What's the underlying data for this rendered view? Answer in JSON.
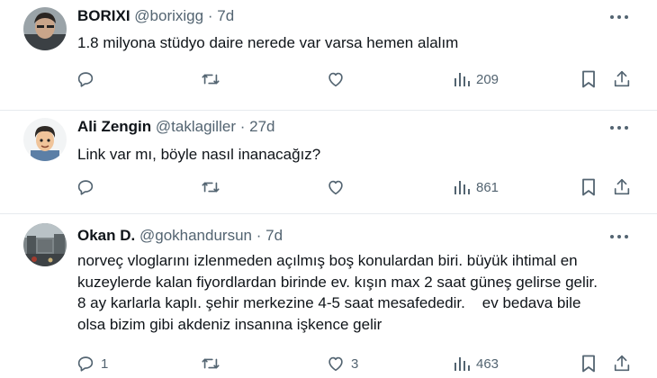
{
  "tweets": [
    {
      "name": "BORIXI",
      "handle": "@borixigg",
      "separator": "·",
      "time": "7d",
      "text_lines": [
        "1.8 milyona stüdyo daire nerede var varsa hemen alalım"
      ],
      "reply_count": "",
      "like_count": "",
      "views": "209"
    },
    {
      "name": "Ali Zengin",
      "handle": "@taklagiller",
      "separator": "·",
      "time": "27d",
      "text_lines": [
        "Link var mı, böyle nasıl inanacağız?"
      ],
      "reply_count": "",
      "like_count": "",
      "views": "861"
    },
    {
      "name": "Okan D.",
      "handle": "@gokhandursun",
      "separator": "·",
      "time": "7d",
      "text_lines": [
        "norveç vlogları​nı izlenmeden açılmış boş konulardan biri. büyük ihtimal en",
        "kuzeylerde kalan fiyordlardan birinde ev. kışın max 2 saat güneş gelirse gelir.",
        "8 ay karlarla kaplı. şehir merkezine 4-5 saat mesafededir.    ev bedava bile",
        "olsa bizim gibi akdeniz insanına işkence gelir"
      ],
      "reply_count": "1",
      "like_count": "3",
      "views": "463"
    }
  ],
  "icons": {
    "reply": "reply-icon",
    "retweet": "retweet-icon",
    "like": "heart-icon",
    "views": "views-icon",
    "bookmark": "bookmark-icon",
    "share": "share-icon",
    "more": "more-icon"
  },
  "colors": {
    "text": "#0f1419",
    "secondary": "#536471",
    "divider": "#e6ebee"
  }
}
